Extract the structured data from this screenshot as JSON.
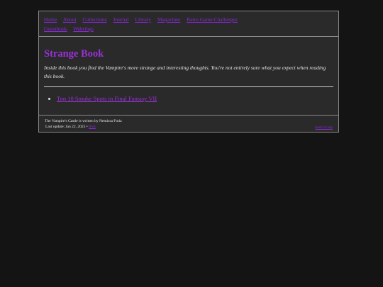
{
  "nav": {
    "links": [
      "Home",
      "About",
      "Collections",
      "Journal",
      "Library",
      "Magazines",
      "Retro Game Challenges",
      "Guestbook",
      "Webrings"
    ]
  },
  "main": {
    "title": "Strange Book",
    "description": "Inside this book you find the Vampire's more strange and interesting thoughts. You're not entirely sure what you expect when reading this book.",
    "items": [
      "Top 10 Smoke Spots in Final Fantasy VII"
    ]
  },
  "footer": {
    "credit": "The Vampire's Castle is written by Nemissa Fotia",
    "last_update": "Last update: Jan 22, 2025 •",
    "rss_label": "RSS",
    "back_to_top": "back to top"
  },
  "colors": {
    "background": "#141414",
    "panel": "#2a2a2a",
    "accent": "#9b2fd8"
  }
}
